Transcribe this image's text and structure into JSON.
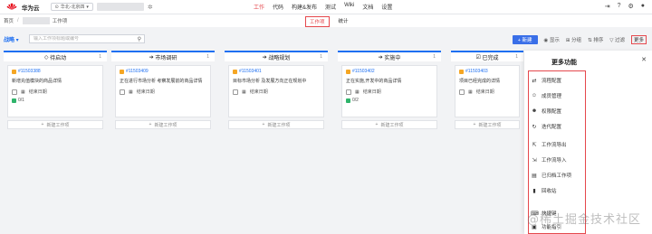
{
  "topbar": {
    "brand": "华为云",
    "region": "华北-北京四",
    "nav": [
      "工作",
      "代码",
      "构建&发布",
      "测试",
      "Wiki",
      "文档",
      "设置"
    ],
    "active_nav": "工作",
    "icons": [
      "exit-icon",
      "help-icon",
      "gear-icon",
      "avatar"
    ]
  },
  "subbar": {
    "home": "首页",
    "crumb": "工作项",
    "tabs": [
      "工作项",
      "统计"
    ],
    "active_tab": "工作项"
  },
  "toolbar": {
    "view": "战略",
    "search_placeholder": "输入工作项标题或编号",
    "new_label": "+ 新建",
    "filter": "显示",
    "group": "分组",
    "sort": "排序",
    "filter2": "过滤",
    "more": "更多"
  },
  "columns": [
    {
      "name": "待启动",
      "icon": "◇",
      "count": "1",
      "card": {
        "id": "#11503388",
        "title": "新增充值模块的商品详情",
        "end": "结束日期",
        "progress": "0/1"
      },
      "add": "新建工作项"
    },
    {
      "name": "市场调研",
      "icon": "➔",
      "count": "1",
      "card": {
        "id": "#11503409",
        "title": "正在进行市场分析 考察发展前的商品详情",
        "end": "结束日期",
        "progress": ""
      },
      "add": "新建工作项"
    },
    {
      "name": "战略规划",
      "icon": "➔",
      "count": "1",
      "card": {
        "id": "#11503401",
        "title": "目标市场分析 及发展方向正在规划中",
        "end": "结束日期",
        "progress": ""
      },
      "add": "新建工作项"
    },
    {
      "name": "实施中",
      "icon": "➔",
      "count": "1",
      "card": {
        "id": "#11503402",
        "title": "正在实施,开发中的商品详情",
        "end": "结束日期",
        "progress": "0/2"
      },
      "add": "新建工作项"
    },
    {
      "name": "已完成",
      "icon": "☑",
      "count": "1",
      "card": {
        "id": "#11503403",
        "title": "项目已经完成的详情",
        "end": "结束日期",
        "progress": ""
      },
      "add": "新建工作项"
    }
  ],
  "more_panel": {
    "title": "更多功能",
    "items": [
      {
        "label": "流程配置",
        "icon": "workflow-icon"
      },
      {
        "label": "成员管理",
        "icon": "user-icon"
      },
      {
        "label": "权限配置",
        "icon": "user-permission-icon"
      },
      {
        "label": "迭代配置",
        "icon": "iteration-icon"
      },
      {
        "label": "工作流导出",
        "icon": "export-icon"
      },
      {
        "label": "工作流导入",
        "icon": "import-icon"
      },
      {
        "label": "已归档工作项",
        "icon": "archive-icon"
      },
      {
        "label": "回收站",
        "icon": "trash-icon"
      },
      {
        "label": "快捷键",
        "icon": "keyboard-icon"
      },
      {
        "label": "功能指引",
        "icon": "guide-icon"
      }
    ]
  },
  "watermark": "@稀土掘金技术社区",
  "colors": {
    "accent": "#1e6ff1",
    "highlight": "#e5484d",
    "new_button": "#3a6fe8"
  }
}
